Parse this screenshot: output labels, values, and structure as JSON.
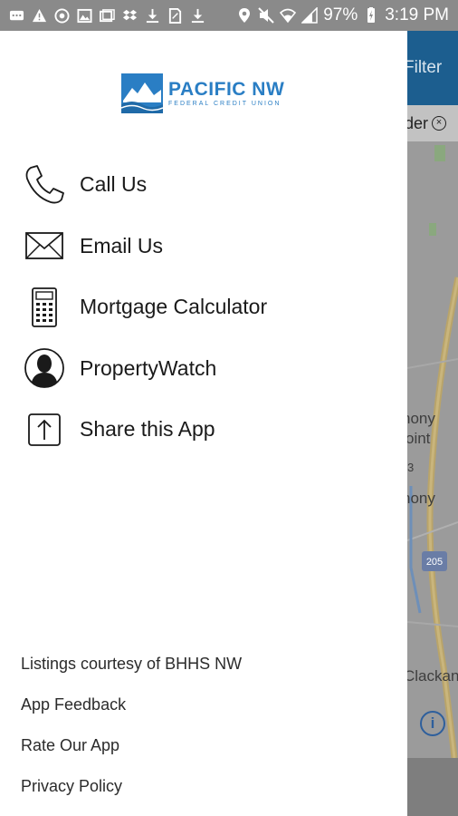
{
  "status_bar": {
    "battery": "97%",
    "time": "3:19 PM",
    "left_icons": [
      "message-icon",
      "warning-icon",
      "target-icon",
      "image-icon",
      "gallery-icon",
      "dropbox-icon",
      "download-icon",
      "file-icon",
      "download-icon"
    ],
    "right_icons": [
      "location-icon",
      "mute-icon",
      "wifi-icon",
      "signal-icon",
      "battery-icon"
    ]
  },
  "background_app": {
    "toolbar_label": "Filter",
    "chip_text": "der",
    "chip_close": "×",
    "map_labels": [
      "nony",
      "oint",
      "3",
      "nony",
      "205",
      "Clackan"
    ],
    "info_icon": "i"
  },
  "drawer": {
    "logo": {
      "name": "PACIFIC NW",
      "subtitle": "FEDERAL CREDIT UNION"
    },
    "menu": [
      {
        "label": "Call Us",
        "icon": "phone-icon"
      },
      {
        "label": "Email Us",
        "icon": "envelope-icon"
      },
      {
        "label": "Mortgage Calculator",
        "icon": "calculator-icon"
      },
      {
        "label": "PropertyWatch",
        "icon": "person-icon"
      },
      {
        "label": "Share this App",
        "icon": "share-icon"
      }
    ],
    "footer": [
      {
        "label": "Listings courtesy of BHHS NW"
      },
      {
        "label": "App Feedback"
      },
      {
        "label": "Rate Our App"
      },
      {
        "label": "Privacy Policy"
      }
    ]
  },
  "colors": {
    "brand_blue": "#2a7ec4",
    "toolbar_blue": "#1c5e8f",
    "status_bar": "#8a8a8a",
    "scrim_map": "#9b9b9b"
  }
}
